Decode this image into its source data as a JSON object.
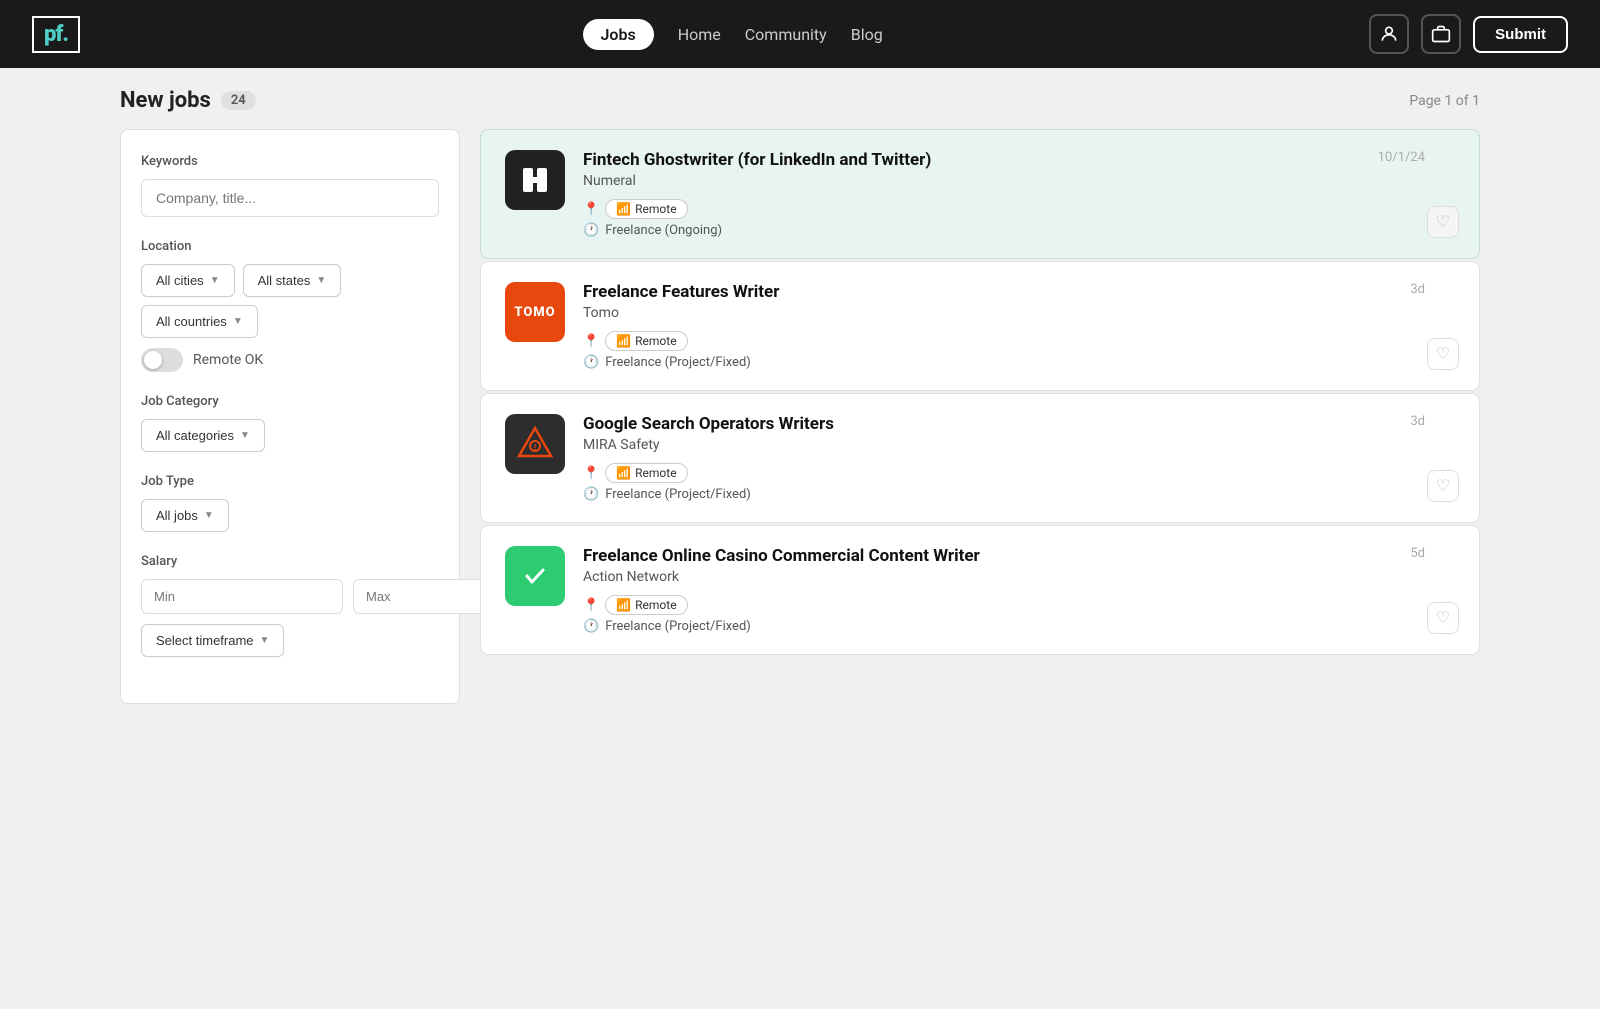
{
  "header": {
    "logo_text": "pf.",
    "nav": [
      {
        "id": "jobs",
        "label": "Jobs",
        "active": true
      },
      {
        "id": "home",
        "label": "Home",
        "active": false
      },
      {
        "id": "community",
        "label": "Community",
        "active": false
      },
      {
        "id": "blog",
        "label": "Blog",
        "active": false
      }
    ],
    "submit_label": "Submit"
  },
  "page": {
    "title": "New jobs",
    "count": "24",
    "page_info": "Page 1 of 1"
  },
  "sidebar": {
    "keywords_label": "Keywords",
    "keywords_placeholder": "Company, title...",
    "location_label": "Location",
    "all_cities": "All cities",
    "all_states": "All states",
    "all_countries": "All countries",
    "remote_ok": "Remote OK",
    "job_category_label": "Job Category",
    "all_categories": "All categories",
    "job_type_label": "Job Type",
    "all_jobs": "All jobs",
    "salary_label": "Salary",
    "min_placeholder": "Min",
    "max_placeholder": "Max",
    "timeframe_label": "Select timeframe"
  },
  "jobs": [
    {
      "id": 1,
      "title": "Fintech Ghostwriter (for LinkedIn and Twitter)",
      "company": "Numeral",
      "logo_type": "numeral",
      "logo_text": "N",
      "remote": true,
      "remote_label": "Remote",
      "job_type": "Freelance (Ongoing)",
      "date": "10/1/24",
      "featured": true
    },
    {
      "id": 2,
      "title": "Freelance Features Writer",
      "company": "Tomo",
      "logo_type": "tomo",
      "logo_text": "TOMO",
      "remote": true,
      "remote_label": "Remote",
      "job_type": "Freelance (Project/Fixed)",
      "date": "3d",
      "featured": false
    },
    {
      "id": 3,
      "title": "Google Search Operators Writers",
      "company": "MIRA Safety",
      "logo_type": "mira",
      "logo_text": "⚠",
      "remote": true,
      "remote_label": "Remote",
      "job_type": "Freelance (Project/Fixed)",
      "date": "3d",
      "featured": false
    },
    {
      "id": 4,
      "title": "Freelance Online Casino Commercial Content Writer",
      "company": "Action Network",
      "logo_type": "action",
      "logo_text": "✓",
      "remote": true,
      "remote_label": "Remote",
      "job_type": "Freelance (Project/Fixed)",
      "date": "5d",
      "featured": false
    }
  ]
}
